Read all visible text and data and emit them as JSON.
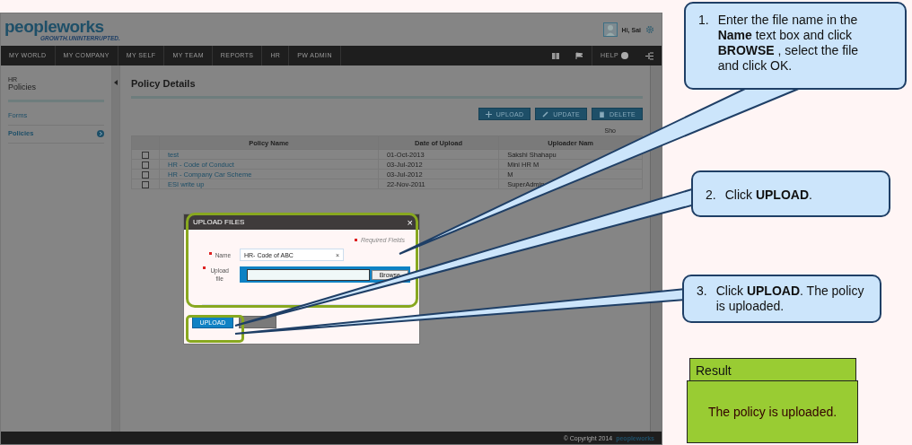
{
  "header": {
    "logo": "peopleworks",
    "tagline": "GROWTH.UNINTERRUPTED.",
    "greeting": "Hi, Sai"
  },
  "nav": {
    "items": [
      "MY WORLD",
      "MY COMPANY",
      "MY SELF",
      "MY TEAM",
      "REPORTS",
      "HR",
      "PW ADMIN"
    ],
    "help": "HELP"
  },
  "sidebar": {
    "section": "HR",
    "title": "Policies",
    "items": [
      {
        "label": "Forms",
        "selected": false
      },
      {
        "label": "Policies",
        "selected": true
      }
    ]
  },
  "main": {
    "title": "Policy Details",
    "buttons": [
      {
        "label": "UPLOAD",
        "kind": "plus"
      },
      {
        "label": "UPDATE",
        "kind": "pencil"
      },
      {
        "label": "DELETE",
        "kind": "trash"
      }
    ],
    "show": "Sho",
    "table": {
      "columns": [
        "Policy Name",
        "Date of Upload",
        "Uploader Nam"
      ],
      "rows": [
        {
          "checked": false,
          "cells": [
            "test",
            "01-Oct-2013",
            "Sakshi Shahapu"
          ]
        },
        {
          "checked": false,
          "cells": [
            "HR - Code of Conduct",
            "03-Jul-2012",
            "Mini HR M"
          ]
        },
        {
          "checked": false,
          "cells": [
            "HR - Company Car Scheme",
            "03-Jul-2012",
            "M"
          ]
        },
        {
          "checked": false,
          "cells": [
            "ESI write up",
            "22-Nov-2011",
            "SuperAdmin"
          ]
        }
      ]
    }
  },
  "dialog": {
    "title": "UPLOAD FILES",
    "close": "×",
    "required": "Required Fields",
    "name_label": "Name",
    "name_value": "HR- Code of ABC",
    "clear": "×",
    "file_label": "Upload file",
    "browse": "Browse",
    "upload": "UPLOAD"
  },
  "footer": {
    "copyright": "© Copyright 2014",
    "logo": "peopleworks"
  },
  "callouts": [
    {
      "number": "1.",
      "text": "Enter the file name in the **Name** text box and click **BROWSE** , select the file and click OK."
    },
    {
      "number": "2.",
      "text": "Click **UPLOAD**."
    },
    {
      "number": "3.",
      "text": "Click **UPLOAD**. The policy is uploaded."
    }
  ],
  "result": {
    "title": "Result",
    "text": "The policy  is uploaded."
  }
}
